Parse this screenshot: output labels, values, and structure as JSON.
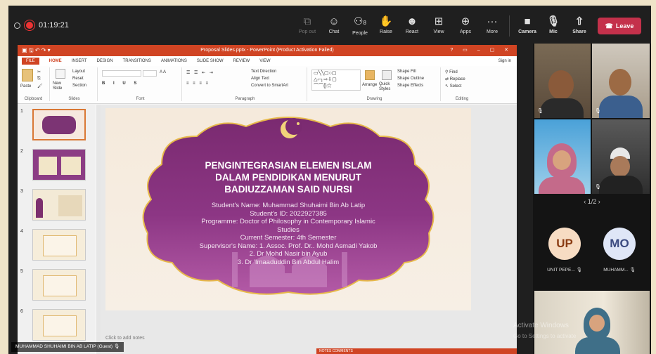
{
  "teams": {
    "rec_time": "01:19:21",
    "controls": [
      {
        "label": "Pop out",
        "icon": "⧉",
        "dim": true
      },
      {
        "label": "Chat",
        "icon": "☺"
      },
      {
        "label": "People",
        "icon": "⚇",
        "badge": "8"
      },
      {
        "label": "Raise",
        "icon": "✋"
      },
      {
        "label": "React",
        "icon": "☻"
      },
      {
        "label": "View",
        "icon": "⊞"
      },
      {
        "label": "Apps",
        "icon": "⊕"
      },
      {
        "label": "More",
        "icon": "···"
      }
    ],
    "device_controls": [
      {
        "label": "Camera",
        "icon": "■"
      },
      {
        "label": "Mic",
        "icon": "🎙"
      },
      {
        "label": "Share",
        "icon": "⇧"
      }
    ],
    "leave_label": "Leave",
    "pager": "1/2",
    "participants": [
      {
        "initials": "UP",
        "name": "UNIT PEPE...",
        "bg": "#f7dcc3",
        "fg": "#8a3b12"
      },
      {
        "initials": "MO",
        "name": "MUHAMM...",
        "bg": "#dfe6f7",
        "fg": "#3b4a80"
      }
    ],
    "presenter_name": "MUHAMMAD SHUHAIMI BIN AB LATIP (Guest)",
    "activate_line1": "Activate Windows",
    "activate_line2": "Go to Settings to activate"
  },
  "ppt": {
    "window_title": "Proposal Slides.pptx - PowerPoint (Product Activation Failed)",
    "tabs": [
      "FILE",
      "HOME",
      "INSERT",
      "DESIGN",
      "TRANSITIONS",
      "ANIMATIONS",
      "SLIDE SHOW",
      "REVIEW",
      "VIEW"
    ],
    "sign_in": "Sign in",
    "groups": [
      "Clipboard",
      "Slides",
      "Font",
      "Paragraph",
      "Drawing",
      "Editing"
    ],
    "ribbon_buttons": {
      "paste": "Paste",
      "new_slide": "New Slide",
      "layout": "Layout",
      "reset": "Reset",
      "section": "Section",
      "text_direction": "Text Direction",
      "align_text": "Align Text",
      "convert_smartart": "Convert to SmartArt",
      "arrange": "Arrange",
      "quick_styles": "Quick Styles",
      "shape_fill": "Shape Fill",
      "shape_outline": "Shape Outline",
      "shape_effects": "Shape Effects",
      "find": "Find",
      "replace": "Replace",
      "select": "Select"
    },
    "thumbnail_numbers": [
      "1",
      "2",
      "3",
      "4",
      "5",
      "6"
    ],
    "notes_placeholder": "Click to add notes",
    "status_items": "NOTES   COMMENTS",
    "slide": {
      "title_lines": [
        "PENGINTEGRASIAN ELEMEN ISLAM",
        "DALAM PENDIDIKAN MENURUT",
        "BADIUZZAMAN SAID NURSI"
      ],
      "body_lines": [
        "Student's Name: Muhammad Shuhaimi Bin Ab Latip",
        "Student's ID: 2022927385",
        "Programme: Doctor of Philosophy in Contemporary Islamic",
        "Studies",
        "Current Semester: 4th Semester",
        "Supervisor's Name: 1. Assoc. Prof. Dr.. Mohd Asmadi Yakob",
        "2. Dr Mohd Nasir bin Ayub",
        "3. Dr 'Imaaduddin Bin Abdul Halim"
      ]
    }
  }
}
